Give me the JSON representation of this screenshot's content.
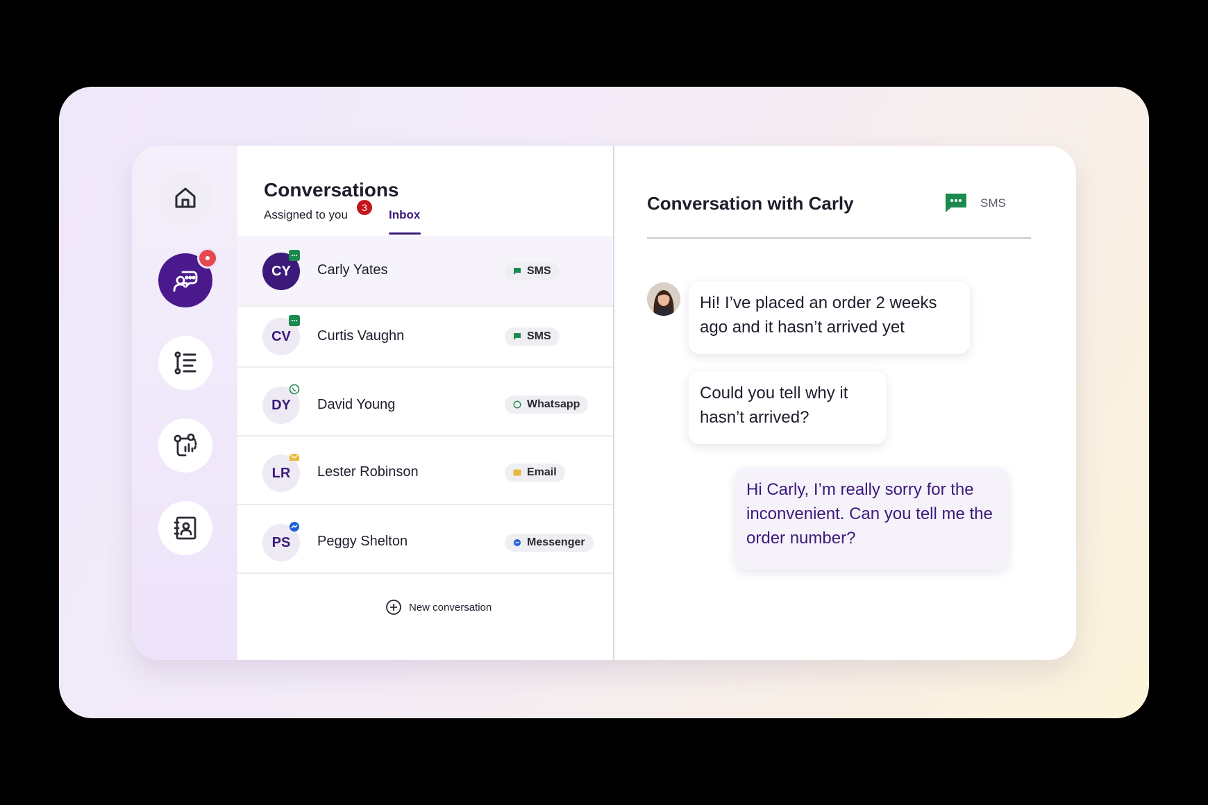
{
  "nav": {
    "items": [
      {
        "name": "home",
        "icon": "home-icon"
      },
      {
        "name": "conversations",
        "icon": "chat-support-icon",
        "active": true,
        "has_notification": true
      },
      {
        "name": "tasks",
        "icon": "list-icon"
      },
      {
        "name": "analytics",
        "icon": "flow-analytics-icon"
      },
      {
        "name": "contacts",
        "icon": "contact-book-icon"
      }
    ]
  },
  "conversations": {
    "title": "Conversations",
    "tabs": {
      "assigned_label": "Assigned to you",
      "assigned_count": "3",
      "inbox_label": "Inbox"
    },
    "rows": [
      {
        "initials": "CY",
        "name": "Carly Yates",
        "channel": "SMS",
        "channel_icon": "sms-icon"
      },
      {
        "initials": "CV",
        "name": "Curtis Vaughn",
        "channel": "SMS",
        "channel_icon": "sms-icon"
      },
      {
        "initials": "DY",
        "name": "David Young",
        "channel": "Whatsapp",
        "channel_icon": "whatsapp-icon"
      },
      {
        "initials": "LR",
        "name": "Lester Robinson",
        "channel": "Email",
        "channel_icon": "email-icon"
      },
      {
        "initials": "PS",
        "name": "Peggy Shelton",
        "channel": "Messenger",
        "channel_icon": "messenger-icon"
      }
    ],
    "new_conversation_label": "New conversation"
  },
  "chat": {
    "title": "Conversation with Carly",
    "channel_label": "SMS",
    "messages": [
      {
        "direction": "in",
        "text": "Hi! I’ve placed an order 2 weeks ago and it hasn’t arrived yet"
      },
      {
        "direction": "in",
        "text": "Could you tell why it hasn’t arrived?"
      },
      {
        "direction": "out",
        "text": "Hi Carly, I’m really sorry for the inconvenient. Can you tell me the order number?"
      }
    ]
  },
  "colors": {
    "brand": "#3b1a7a",
    "sms": "#1c8a4e",
    "whatsapp": "#1c8a4e",
    "email": "#e8b93b",
    "messenger": "#1f5fd6",
    "badge": "#c4161c"
  }
}
